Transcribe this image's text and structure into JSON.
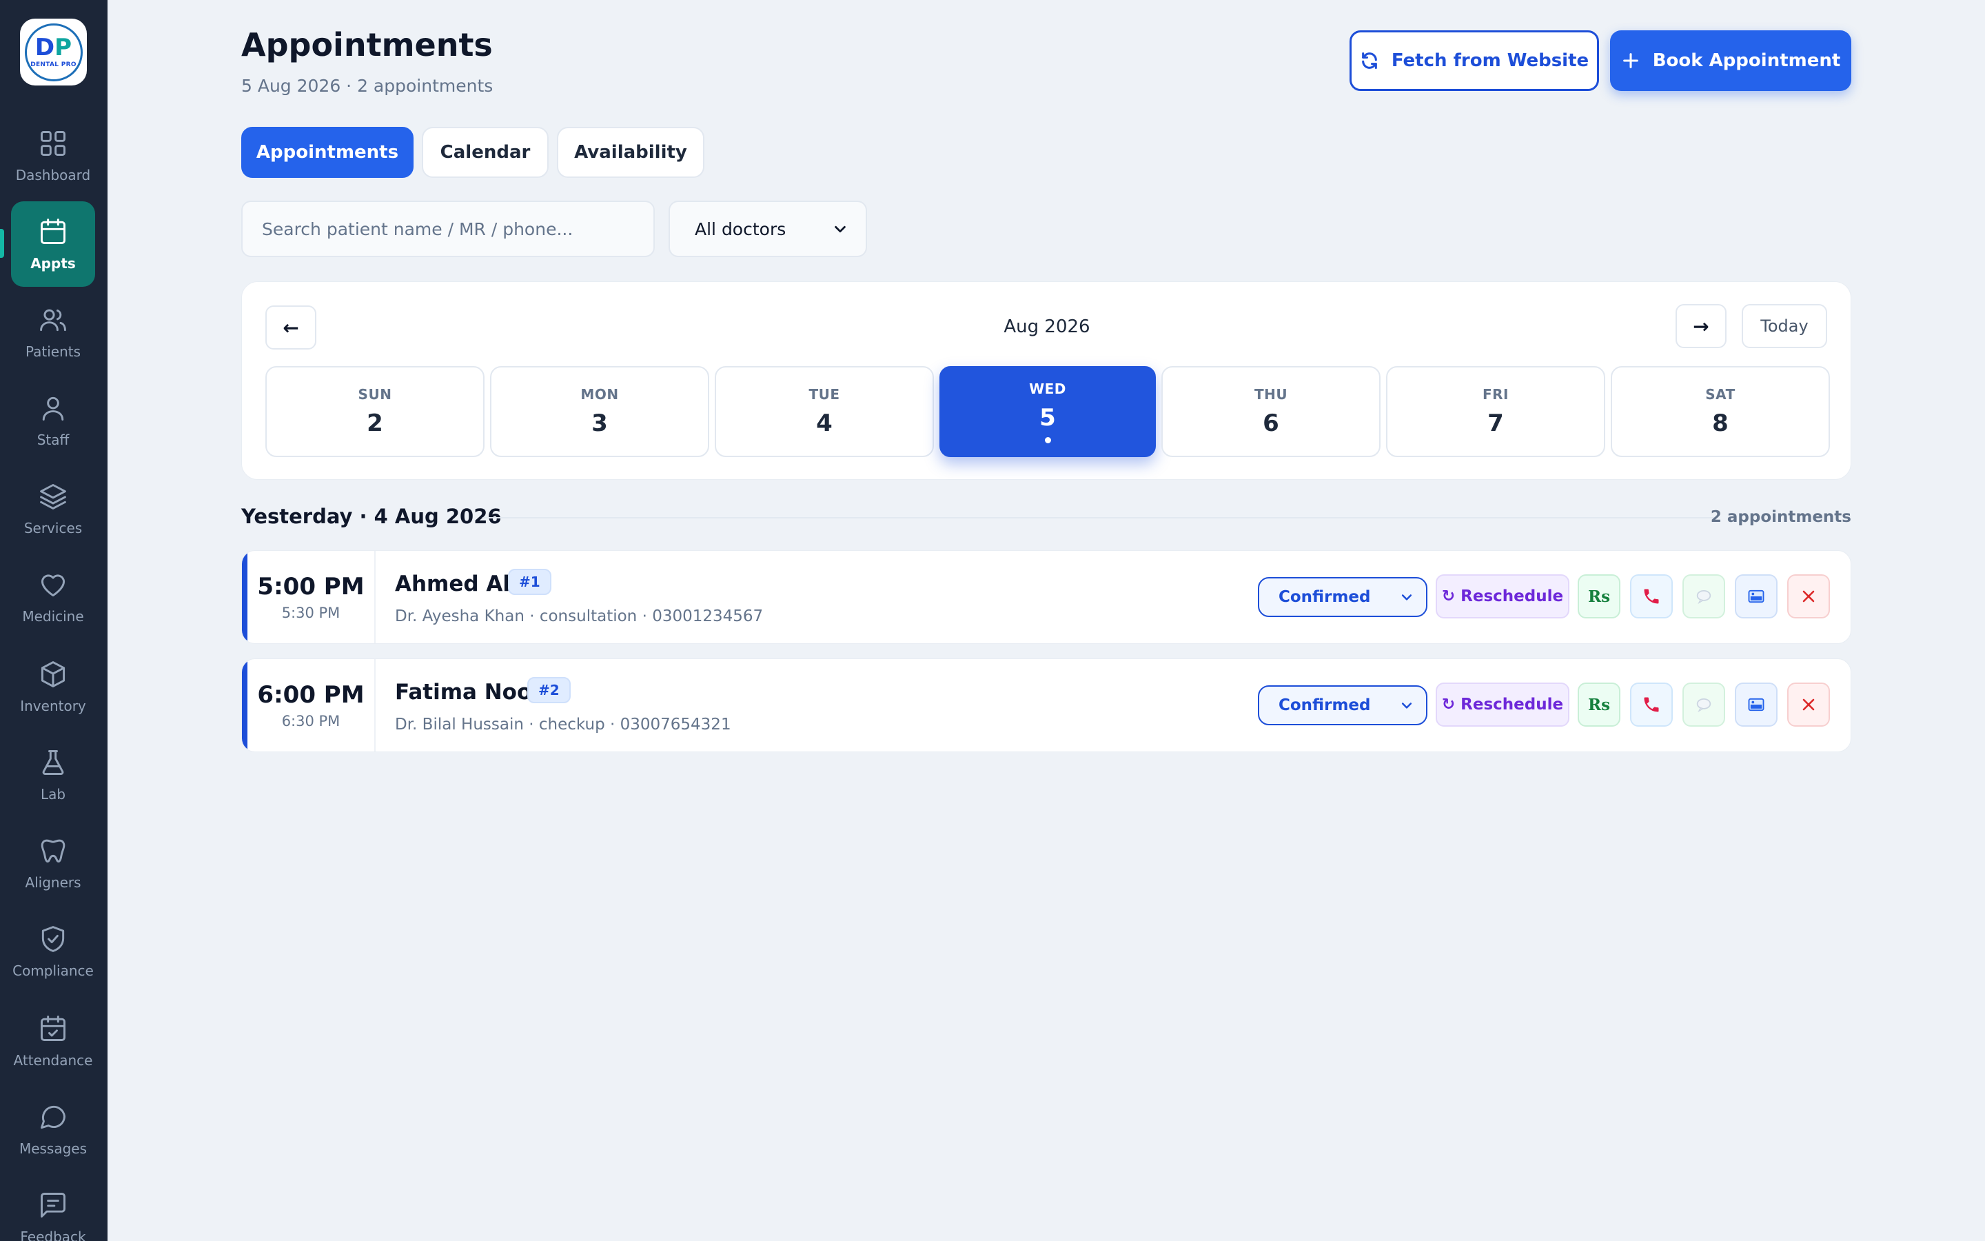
{
  "sidebar": {
    "logo": {
      "mark": "DP",
      "text": "DENTAL PRO"
    },
    "items": [
      {
        "label": "Dashboard",
        "icon": "grid-icon"
      },
      {
        "label": "Appts",
        "icon": "calendar-icon",
        "active": true
      },
      {
        "label": "Patients",
        "icon": "users-icon"
      },
      {
        "label": "Staff",
        "icon": "user-icon"
      },
      {
        "label": "Services",
        "icon": "layers-icon"
      },
      {
        "label": "Medicine",
        "icon": "heart-icon"
      },
      {
        "label": "Inventory",
        "icon": "box-icon"
      },
      {
        "label": "Lab",
        "icon": "flask-icon"
      },
      {
        "label": "Aligners",
        "icon": "tooth-icon"
      },
      {
        "label": "Compliance",
        "icon": "shield-check-icon"
      },
      {
        "label": "Attendance",
        "icon": "calendar-check-icon"
      },
      {
        "label": "Messages",
        "icon": "chat-icon"
      },
      {
        "label": "Feedback",
        "icon": "message-square-icon"
      }
    ]
  },
  "header": {
    "title": "Appointments",
    "subtitle": "5 Aug 2026 · 2 appointments",
    "fetch_label": "Fetch from Website",
    "book_label": "Book Appointment"
  },
  "tabs": [
    {
      "label": "Appointments",
      "active": true
    },
    {
      "label": "Calendar"
    },
    {
      "label": "Availability"
    }
  ],
  "filters": {
    "search_placeholder": "Search patient name / MR / phone...",
    "doctor_value": "All doctors"
  },
  "week": {
    "month_label": "Aug 2026",
    "prev_label": "←",
    "next_label": "→",
    "today_label": "Today",
    "days": [
      {
        "name": "SUN",
        "num": "2"
      },
      {
        "name": "MON",
        "num": "3"
      },
      {
        "name": "TUE",
        "num": "4"
      },
      {
        "name": "WED",
        "num": "5",
        "active": true,
        "has_appointments": true
      },
      {
        "name": "THU",
        "num": "6"
      },
      {
        "name": "FRI",
        "num": "7"
      },
      {
        "name": "SAT",
        "num": "8"
      }
    ]
  },
  "section": {
    "title": "Yesterday · 4 Aug 2026",
    "count": "2 appointments"
  },
  "appointments": [
    {
      "time": "5:00 PM",
      "end_time": "5:30 PM",
      "patient": "Ahmed Ali",
      "badge": "#1",
      "meta": "Dr. Ayesha Khan · consultation · 03001234567",
      "status": "Confirmed",
      "reschedule_label": "Reschedule",
      "fee_label": "Rs"
    },
    {
      "time": "6:00 PM",
      "end_time": "6:30 PM",
      "patient": "Fatima Noor",
      "badge": "#2",
      "meta": "Dr. Bilal Hussain · checkup · 03007654321",
      "status": "Confirmed",
      "reschedule_label": "Reschedule",
      "fee_label": "Rs"
    }
  ],
  "colors": {
    "sidebar_bg": "#1c2638",
    "sidebar_active": "#0f766e",
    "primary": "#2563eb",
    "page_bg": "#eef2f7"
  }
}
